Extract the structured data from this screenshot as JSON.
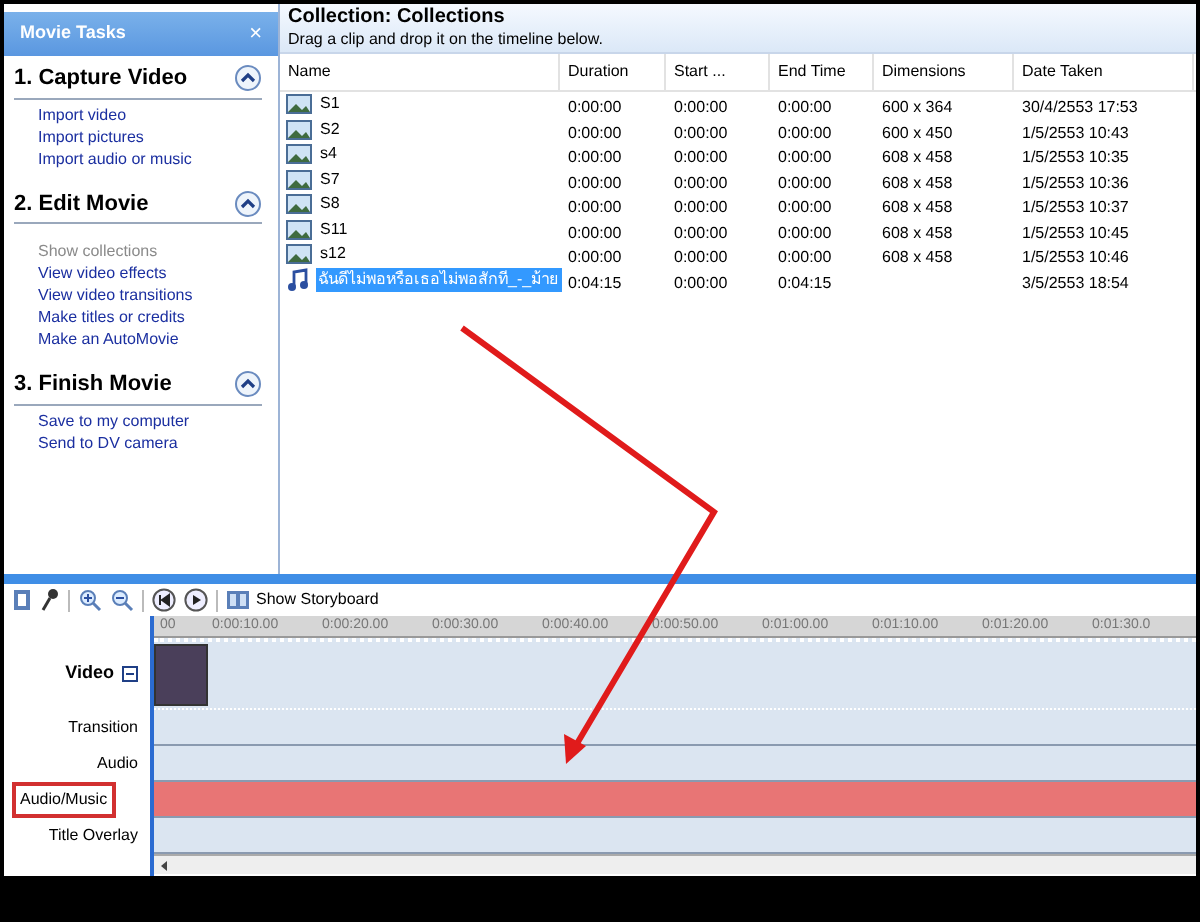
{
  "tasks_panel": {
    "title": "Movie Tasks",
    "close": "×",
    "sections": [
      {
        "title": "1. Capture Video",
        "expanded": true,
        "links": [
          {
            "label": "Import video",
            "disabled": false
          },
          {
            "label": "Import pictures",
            "disabled": false
          },
          {
            "label": "Import audio or music",
            "disabled": false
          }
        ]
      },
      {
        "title": "2. Edit Movie",
        "expanded": true,
        "links": [
          {
            "label": "Show collections",
            "disabled": true
          },
          {
            "label": "View video effects",
            "disabled": false
          },
          {
            "label": "View video transitions",
            "disabled": false
          },
          {
            "label": "Make titles or credits",
            "disabled": false
          },
          {
            "label": "Make an AutoMovie",
            "disabled": false
          }
        ]
      },
      {
        "title": "3. Finish Movie",
        "expanded": true,
        "links": [
          {
            "label": "Save to my computer",
            "disabled": false
          },
          {
            "label": "Send to DV camera",
            "disabled": false
          }
        ]
      }
    ]
  },
  "collection": {
    "title": "Collection: Collections",
    "subtitle": "Drag a clip and drop it on the timeline below.",
    "columns": [
      "Name",
      "Duration",
      "Start ...",
      "End Time",
      "Dimensions",
      "Date Taken"
    ],
    "rows": [
      {
        "kind": "picture",
        "selected": false,
        "cells": [
          "S1",
          "0:00:00",
          "0:00:00",
          "0:00:00",
          "600 x 364",
          "30/4/2553 17:53"
        ]
      },
      {
        "kind": "picture",
        "selected": false,
        "cells": [
          "S2",
          "0:00:00",
          "0:00:00",
          "0:00:00",
          "600 x 450",
          "1/5/2553 10:43"
        ]
      },
      {
        "kind": "picture",
        "selected": false,
        "cells": [
          "s4",
          "0:00:00",
          "0:00:00",
          "0:00:00",
          "608 x 458",
          "1/5/2553 10:35"
        ]
      },
      {
        "kind": "picture",
        "selected": false,
        "cells": [
          "S7",
          "0:00:00",
          "0:00:00",
          "0:00:00",
          "608 x 458",
          "1/5/2553 10:36"
        ]
      },
      {
        "kind": "picture",
        "selected": false,
        "cells": [
          "S8",
          "0:00:00",
          "0:00:00",
          "0:00:00",
          "608 x 458",
          "1/5/2553 10:37"
        ]
      },
      {
        "kind": "picture",
        "selected": false,
        "cells": [
          "S11",
          "0:00:00",
          "0:00:00",
          "0:00:00",
          "608 x 458",
          "1/5/2553 10:45"
        ]
      },
      {
        "kind": "picture",
        "selected": false,
        "cells": [
          "s12",
          "0:00:00",
          "0:00:00",
          "0:00:00",
          "608 x 458",
          "1/5/2553 10:46"
        ]
      },
      {
        "kind": "audio",
        "selected": true,
        "cells": [
          "ฉันดีไม่พอหรือเธอไม่พอสักที_-_ม้าย",
          "0:04:15",
          "0:00:00",
          "0:04:15",
          "",
          "3/5/2553 18:54"
        ]
      }
    ]
  },
  "timeline": {
    "storyboard_button": "Show Storyboard",
    "ticks": [
      "00",
      "0:00:10.00",
      "0:00:20.00",
      "0:00:30.00",
      "0:00:40.00",
      "0:00:50.00",
      "0:01:00.00",
      "0:01:10.00",
      "0:01:20.00",
      "0:01:30.0"
    ],
    "tracks": [
      {
        "kind": "video",
        "label": "Video",
        "highlighted": false
      },
      {
        "kind": "transition",
        "label": "Transition",
        "highlighted": false
      },
      {
        "kind": "audio",
        "label": "Audio",
        "highlighted": false
      },
      {
        "kind": "music",
        "label": "Audio/Music",
        "highlighted": true
      },
      {
        "kind": "overlay",
        "label": "Title Overlay",
        "highlighted": false
      }
    ]
  }
}
